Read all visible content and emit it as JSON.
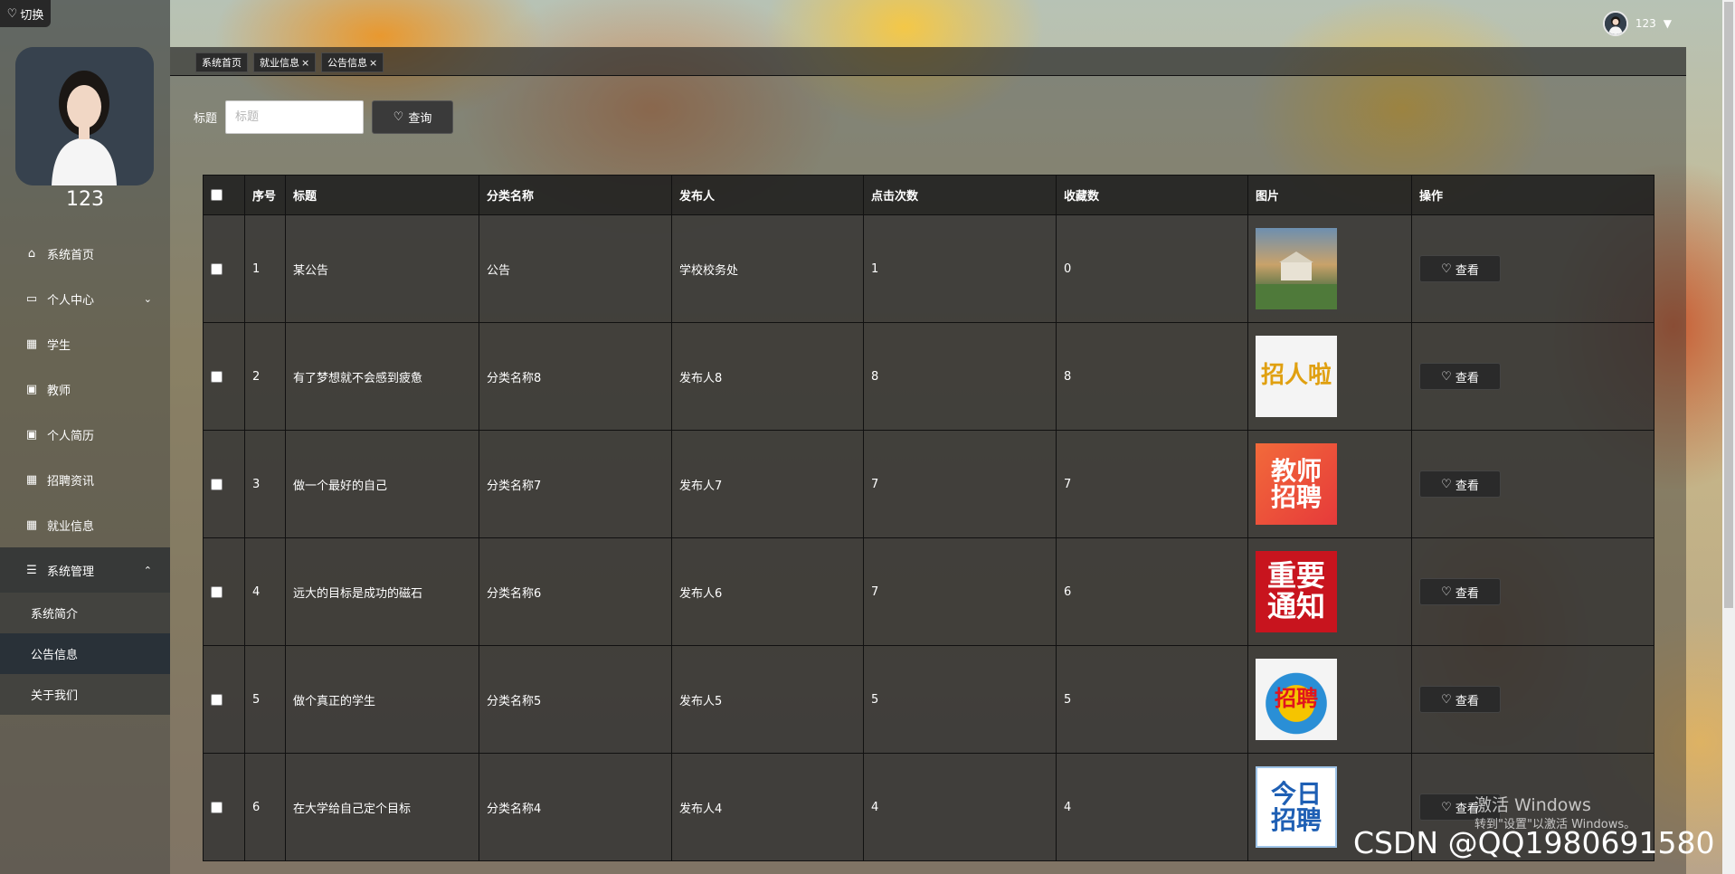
{
  "switch_label": "切换",
  "user": {
    "name": "123"
  },
  "sidebar": {
    "items": [
      {
        "label": "系统首页",
        "icon": "home-icon"
      },
      {
        "label": "个人中心",
        "icon": "id-card-icon"
      },
      {
        "label": "学生",
        "icon": "grid-icon"
      },
      {
        "label": "教师",
        "icon": "clipboard-icon"
      },
      {
        "label": "个人简历",
        "icon": "clipboard-icon"
      },
      {
        "label": "招聘资讯",
        "icon": "grid-icon"
      },
      {
        "label": "就业信息",
        "icon": "grid-icon"
      },
      {
        "label": "系统管理",
        "icon": "menu-icon"
      }
    ],
    "submenu": [
      "系统简介",
      "公告信息",
      "关于我们"
    ]
  },
  "tabs": [
    "系统首页",
    "就业信息",
    "公告信息"
  ],
  "search": {
    "label": "标题",
    "placeholder": "标题",
    "button": "查询"
  },
  "table": {
    "headers": [
      "序号",
      "标题",
      "分类名称",
      "发布人",
      "点击次数",
      "收藏数",
      "图片",
      "操作"
    ],
    "view_label": "查看",
    "rows": [
      {
        "no": "1",
        "title": "某公告",
        "category": "公告",
        "publisher": "学校校务处",
        "clicks": "1",
        "favs": "0",
        "image": "campus-building-photo",
        "image_text": ""
      },
      {
        "no": "2",
        "title": "有了梦想就不会感到疲惫",
        "category": "分类名称8",
        "publisher": "发布人8",
        "clicks": "8",
        "favs": "8",
        "image": "recruit-logo",
        "image_text": "招人啦"
      },
      {
        "no": "3",
        "title": "做一个最好的自己",
        "category": "分类名称7",
        "publisher": "发布人7",
        "clicks": "7",
        "favs": "7",
        "image": "teacher-recruit-poster",
        "image_text": "教师招聘"
      },
      {
        "no": "4",
        "title": "远大的目标是成功的磁石",
        "category": "分类名称6",
        "publisher": "发布人6",
        "clicks": "7",
        "favs": "6",
        "image": "important-notice-poster",
        "image_text": "重要通知"
      },
      {
        "no": "5",
        "title": "做个真正的学生",
        "category": "分类名称5",
        "publisher": "发布人5",
        "clicks": "5",
        "favs": "5",
        "image": "recruit-badge",
        "image_text": "招聘"
      },
      {
        "no": "6",
        "title": "在大学给自己定个目标",
        "category": "分类名称4",
        "publisher": "发布人4",
        "clicks": "4",
        "favs": "4",
        "image": "today-recruit-poster",
        "image_text": "今日招聘"
      }
    ]
  },
  "watermark": {
    "line1": "激活 Windows",
    "line2": "转到\"设置\"以激活 Windows。"
  },
  "csdn": "CSDN @QQ1980691580"
}
